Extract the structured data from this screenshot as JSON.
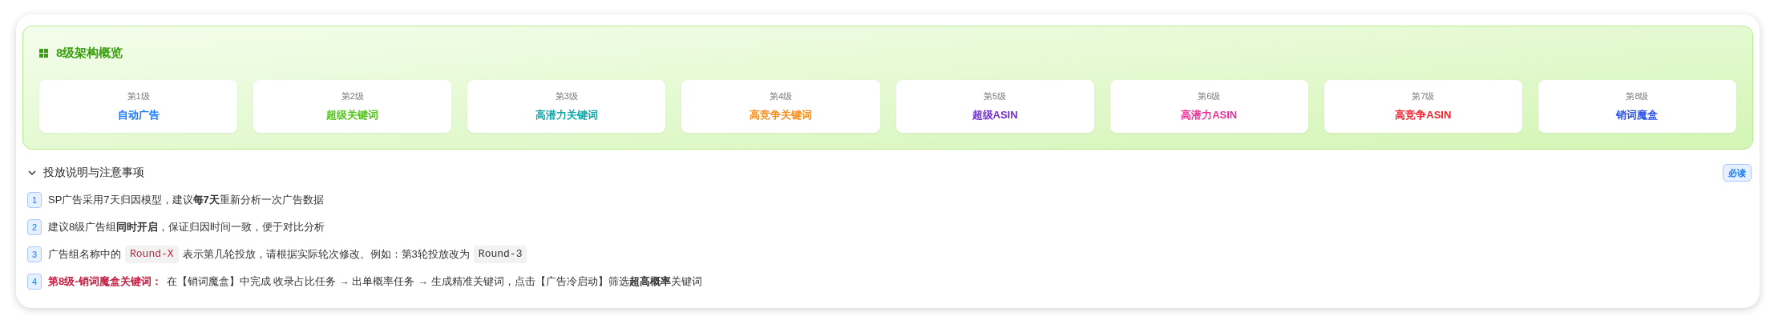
{
  "overview": {
    "title": "8级架构概览",
    "levels": [
      {
        "level": "第1级",
        "name": "自动广告",
        "color": "#1677ff"
      },
      {
        "level": "第2级",
        "name": "超级关键词",
        "color": "#52c41a"
      },
      {
        "level": "第3级",
        "name": "高潜力关键词",
        "color": "#13a8a8"
      },
      {
        "level": "第4级",
        "name": "高竞争关键词",
        "color": "#fa8c16"
      },
      {
        "level": "第5级",
        "name": "超级ASIN",
        "color": "#722ed1"
      },
      {
        "level": "第6级",
        "name": "高潜力ASIN",
        "color": "#eb2f96"
      },
      {
        "level": "第7级",
        "name": "高竞争ASIN",
        "color": "#f5222d"
      },
      {
        "level": "第8级",
        "name": "销词魔盒",
        "color": "#2f54eb"
      }
    ]
  },
  "notes": {
    "title": "投放说明与注意事项",
    "expanded": true,
    "badge": "必读",
    "items": [
      {
        "number": "1",
        "parts": [
          {
            "kind": "text",
            "text": "SP广告采用7天归因模型，建议**每7天**重新分析一次广告数据"
          }
        ]
      },
      {
        "number": "2",
        "parts": [
          {
            "kind": "text",
            "text": "建议8级广告组**同时开启**，保证归因时间一致，便于对比分析"
          }
        ]
      },
      {
        "number": "3",
        "parts": [
          {
            "kind": "text",
            "text": "广告组名称中的"
          },
          {
            "kind": "code",
            "text": "Round-X"
          },
          {
            "kind": "text",
            "text": "表示第几轮投放，请根据实际轮次修改。例如：第3轮投放改为"
          },
          {
            "kind": "code",
            "text": "Round-3"
          }
        ]
      },
      {
        "number": "4",
        "parts": [
          {
            "kind": "label",
            "text": "第8级-销词魔盒关键词："
          },
          {
            "kind": "text",
            "text": "在【销词魔盒】中完成 收录占比任务 → 出单概率任务 → 生成精准关键词，点击【广告冷启动】筛选**超高概率**关键词"
          }
        ]
      }
    ]
  }
}
